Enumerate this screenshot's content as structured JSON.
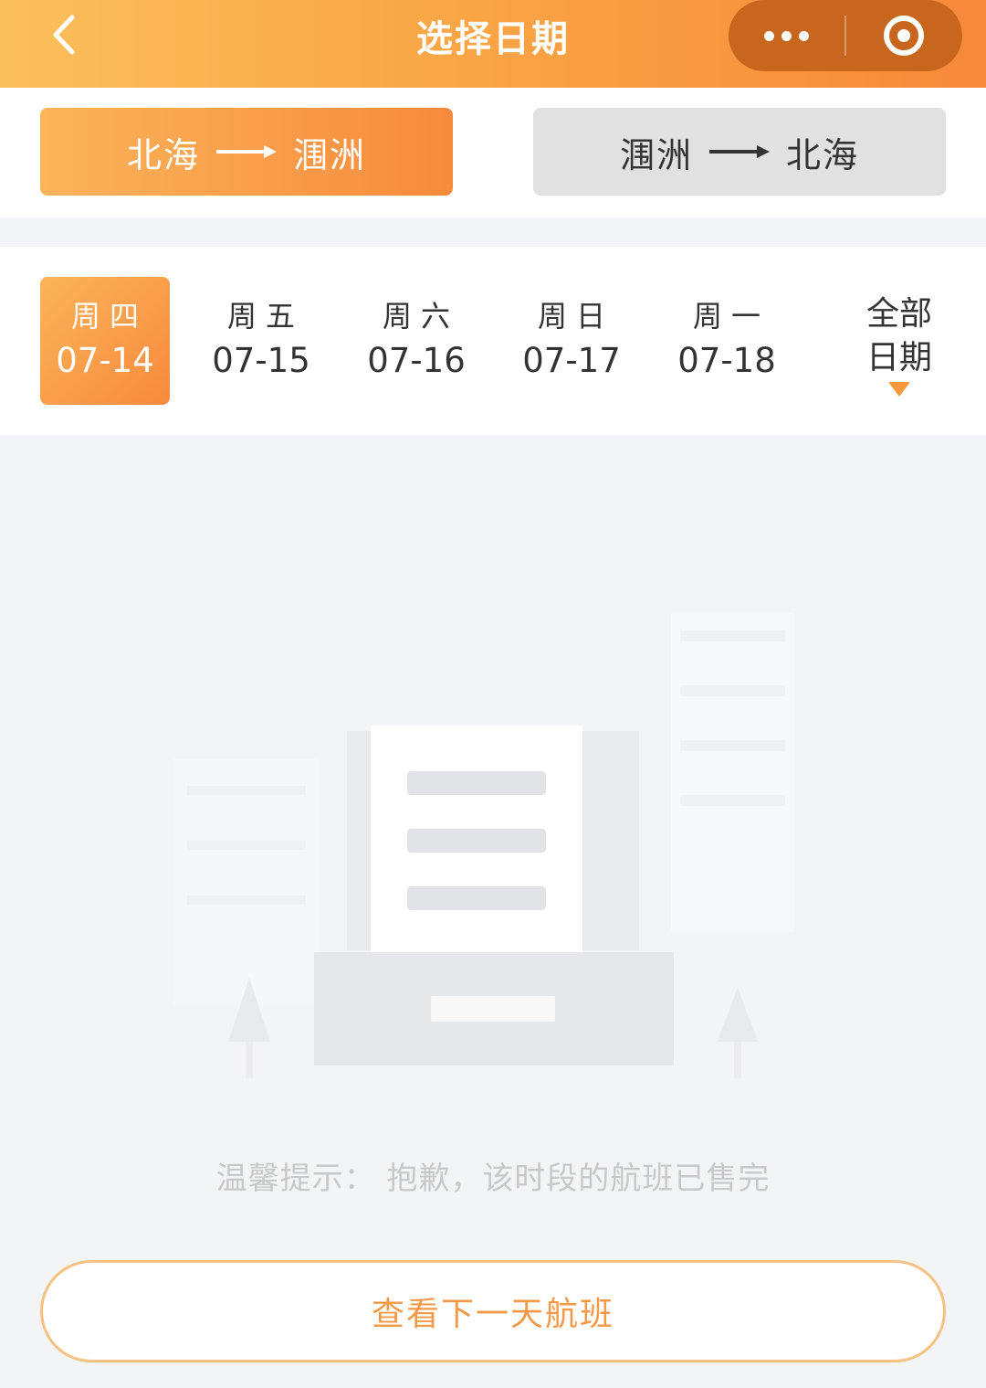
{
  "header": {
    "title": "选择日期",
    "back_icon": "chevron-left-icon",
    "more_icon": "more-dots-icon",
    "close_icon": "target-circle-icon"
  },
  "routes": [
    {
      "from": "北海",
      "to": "涠洲",
      "active": true
    },
    {
      "from": "涠洲",
      "to": "北海",
      "active": false
    }
  ],
  "dates": [
    {
      "weekday": "周四",
      "date": "07-14",
      "active": true
    },
    {
      "weekday": "周五",
      "date": "07-15",
      "active": false
    },
    {
      "weekday": "周六",
      "date": "07-16",
      "active": false
    },
    {
      "weekday": "周日",
      "date": "07-17",
      "active": false
    },
    {
      "weekday": "周一",
      "date": "07-18",
      "active": false
    }
  ],
  "all_dates": {
    "line1": "全部",
    "line2": "日期"
  },
  "empty_state": {
    "hint": "温馨提示： 抱歉，该时段的航班已售完"
  },
  "next_button": {
    "label": "查看下一天航班"
  },
  "colors": {
    "accent": "#f7893a",
    "accent_light": "#fbb45a",
    "inactive_bg": "#e1e1e1",
    "hint": "#c8c8c8"
  }
}
